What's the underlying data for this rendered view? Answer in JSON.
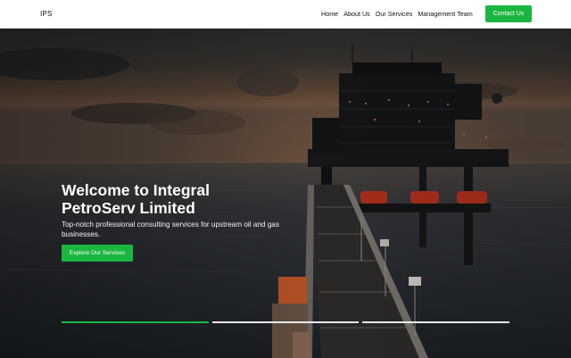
{
  "nav": {
    "logo": "IPS",
    "links": [
      "Home",
      "About Us",
      "Our Services",
      "Management Team"
    ],
    "contact_label": "Contact Us"
  },
  "hero": {
    "title": "Welcome to Integral PetroServ Limited",
    "subtitle": "Top-notch professional consulting services for upstream oil and gas businesses.",
    "cta_label": "Explore Our Services",
    "slides_total": 3,
    "active_slide": 1
  },
  "colors": {
    "accent": "#1bb640",
    "nav_bg": "#ffffff",
    "text_light": "#ffffff"
  }
}
